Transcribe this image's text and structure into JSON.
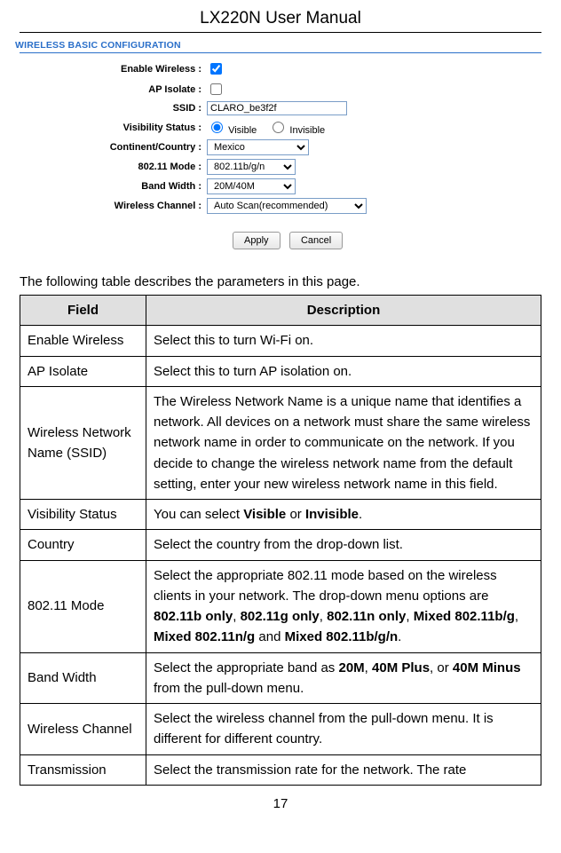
{
  "header": "LX220N User Manual",
  "section_title": "WIRELESS BASIC CONFIGURATION",
  "config": {
    "enable_wireless_label": "Enable Wireless :",
    "ap_isolate_label": "AP Isolate :",
    "ssid_label": "SSID :",
    "ssid_value": "CLARO_be3f2f",
    "visibility_label": "Visibility Status :",
    "visibility_visible": "Visible",
    "visibility_invisible": "Invisible",
    "country_label": "Continent/Country :",
    "country_value": "Mexico",
    "mode_label": "802.11 Mode :",
    "mode_value": "802.11b/g/n",
    "band_label": "Band Width :",
    "band_value": "20M/40M",
    "channel_label": "Wireless Channel :",
    "channel_value": "Auto Scan(recommended)",
    "apply_btn": "Apply",
    "cancel_btn": "Cancel"
  },
  "intro": "The following table describes the parameters in this page.",
  "th_field": "Field",
  "th_desc": "Description",
  "rows": {
    "r0": {
      "field": "Enable Wireless",
      "desc": "Select this to turn Wi-Fi on."
    },
    "r1": {
      "field": "AP Isolate",
      "desc": "Select this to turn AP isolation on."
    },
    "r2": {
      "field": "Wireless Network Name (SSID)",
      "desc": "The Wireless Network Name is a unique name that identifies a network. All devices on a network must share the same wireless network name in order to communicate on the network. If you decide to change the wireless network name from the default setting, enter your new wireless network name in this field."
    },
    "r3": {
      "field": "Visibility Status",
      "desc_pre": "You can select ",
      "b1": "Visible",
      "mid": " or ",
      "b2": "Invisible",
      "post": "."
    },
    "r4": {
      "field": "Country",
      "desc": "Select the country from the drop-down list."
    },
    "r5": {
      "field": "802.11 Mode",
      "pre": "Select the appropriate 802.11 mode based on the wireless clients in your network. The drop-down menu options are ",
      "b1": "802.11b only",
      "c1": ", ",
      "b2": "802.11g only",
      "c2": ", ",
      "b3": "802.11n only",
      "c3": ", ",
      "b4": "Mixed 802.11b/g",
      "c4": ", ",
      "b5": "Mixed 802.11n/g",
      "c5": " and ",
      "b6": "Mixed 802.11b/g/n",
      "post": "."
    },
    "r6": {
      "field": "Band Width",
      "pre": "Select the appropriate band as ",
      "b1": "20M",
      "c1": ", ",
      "b2": "40M Plus",
      "c2": ", or ",
      "b3": "40M Minus",
      "post": " from the pull-down menu."
    },
    "r7": {
      "field": "Wireless Channel",
      "desc": "Select the wireless channel from the pull-down menu. It is different for different country."
    },
    "r8": {
      "field": "Transmission",
      "desc": "Select the transmission rate for the network. The rate"
    }
  },
  "page_num": "17"
}
